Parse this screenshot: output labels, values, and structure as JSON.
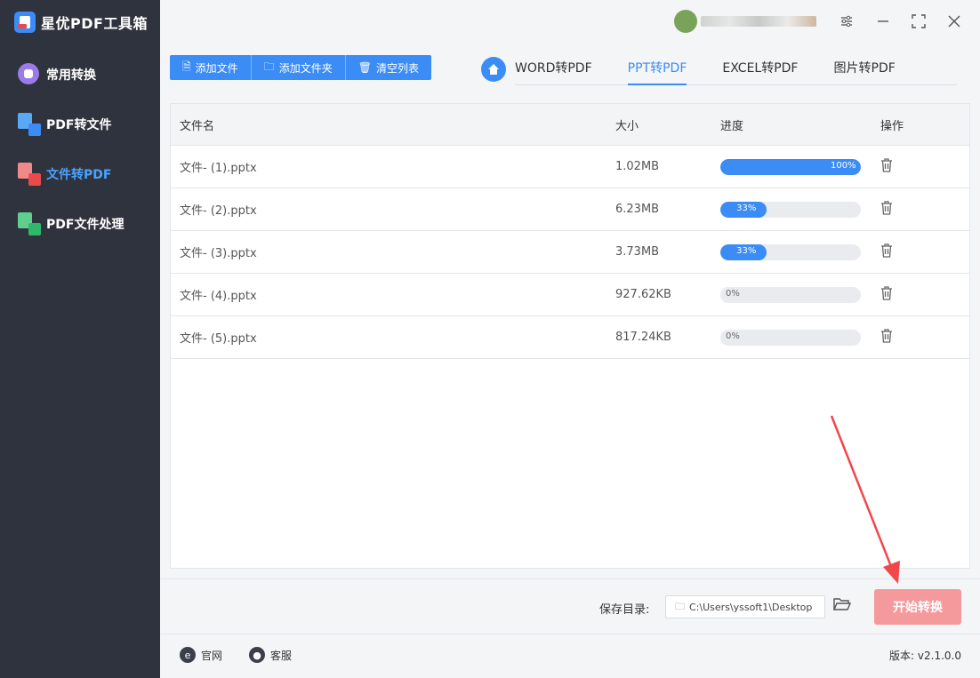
{
  "app": {
    "name": "星优PDF工具箱"
  },
  "sidebar": {
    "items": [
      {
        "label": "常用转换",
        "icon": "apps-icon"
      },
      {
        "label": "PDF转文件",
        "icon": "pdf-to-file-icon"
      },
      {
        "label": "文件转PDF",
        "icon": "file-to-pdf-icon",
        "active": true
      },
      {
        "label": "PDF文件处理",
        "icon": "pdf-process-icon"
      }
    ]
  },
  "toolbar": {
    "add_file": "添加文件",
    "add_folder": "添加文件夹",
    "clear_list": "清空列表"
  },
  "tabs": [
    {
      "label": "WORD转PDF"
    },
    {
      "label": "PPT转PDF",
      "active": true
    },
    {
      "label": "EXCEL转PDF"
    },
    {
      "label": "图片转PDF"
    }
  ],
  "table": {
    "headers": {
      "name": "文件名",
      "size": "大小",
      "progress": "进度",
      "action": "操作"
    },
    "rows": [
      {
        "name": "文件- (1).pptx",
        "size": "1.02MB",
        "progress": 100,
        "progress_label": "100%"
      },
      {
        "name": "文件- (2).pptx",
        "size": "6.23MB",
        "progress": 33,
        "progress_label": "33%"
      },
      {
        "name": "文件- (3).pptx",
        "size": "3.73MB",
        "progress": 33,
        "progress_label": "33%"
      },
      {
        "name": "文件- (4).pptx",
        "size": "927.62KB",
        "progress": 0,
        "progress_label": "0%"
      },
      {
        "name": "文件- (5).pptx",
        "size": "817.24KB",
        "progress": 0,
        "progress_label": "0%"
      }
    ]
  },
  "footer": {
    "save_label": "保存目录:",
    "save_path": "C:\\Users\\yssoft1\\Desktop",
    "start_button": "开始转换",
    "website": "官网",
    "support": "客服",
    "version": "版本: v2.1.0.0"
  },
  "colors": {
    "sidebar_bg": "#2f333d",
    "accent": "#3b8cf5",
    "start_button": "#f59a9c",
    "annotation_arrow": "#f0474a"
  }
}
